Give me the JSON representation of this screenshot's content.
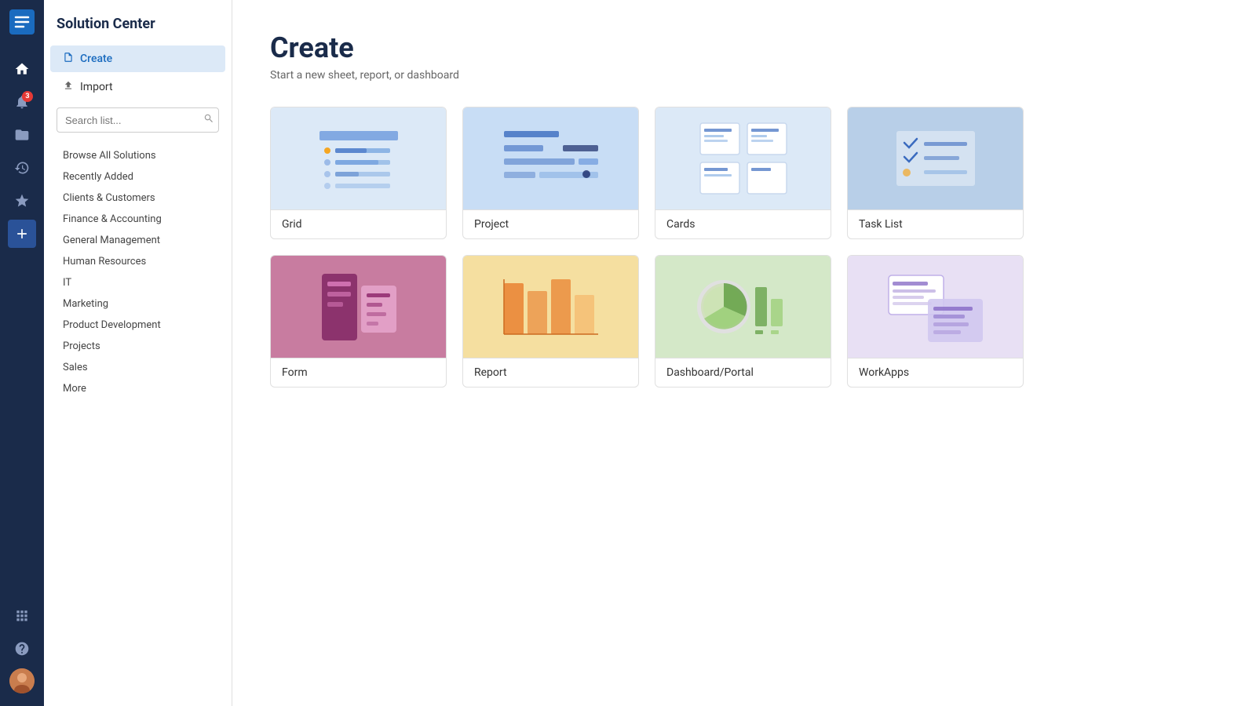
{
  "app": {
    "logo": "smartsheet",
    "nav_badge": "3"
  },
  "sidebar": {
    "title": "Solution Center",
    "nav_items": [
      {
        "id": "create",
        "label": "Create",
        "icon": "📄",
        "active": true
      },
      {
        "id": "import",
        "label": "Import",
        "icon": "⬆",
        "active": false
      }
    ],
    "search_placeholder": "Search list...",
    "categories": [
      {
        "id": "browse",
        "label": "Browse All Solutions"
      },
      {
        "id": "recently-added",
        "label": "Recently Added"
      },
      {
        "id": "clients",
        "label": "Clients & Customers"
      },
      {
        "id": "finance",
        "label": "Finance & Accounting"
      },
      {
        "id": "general",
        "label": "General Management"
      },
      {
        "id": "hr",
        "label": "Human Resources"
      },
      {
        "id": "it",
        "label": "IT"
      },
      {
        "id": "marketing",
        "label": "Marketing"
      },
      {
        "id": "product",
        "label": "Product Development"
      },
      {
        "id": "projects",
        "label": "Projects"
      },
      {
        "id": "sales",
        "label": "Sales"
      },
      {
        "id": "more",
        "label": "More"
      }
    ]
  },
  "main": {
    "title": "Create",
    "subtitle": "Start a new sheet, report, or dashboard",
    "cards": [
      {
        "id": "grid",
        "label": "Grid"
      },
      {
        "id": "project",
        "label": "Project"
      },
      {
        "id": "cards",
        "label": "Cards"
      },
      {
        "id": "tasklist",
        "label": "Task List"
      },
      {
        "id": "form",
        "label": "Form"
      },
      {
        "id": "report",
        "label": "Report"
      },
      {
        "id": "dashboard",
        "label": "Dashboard/Portal"
      },
      {
        "id": "workapps",
        "label": "WorkApps"
      }
    ]
  }
}
